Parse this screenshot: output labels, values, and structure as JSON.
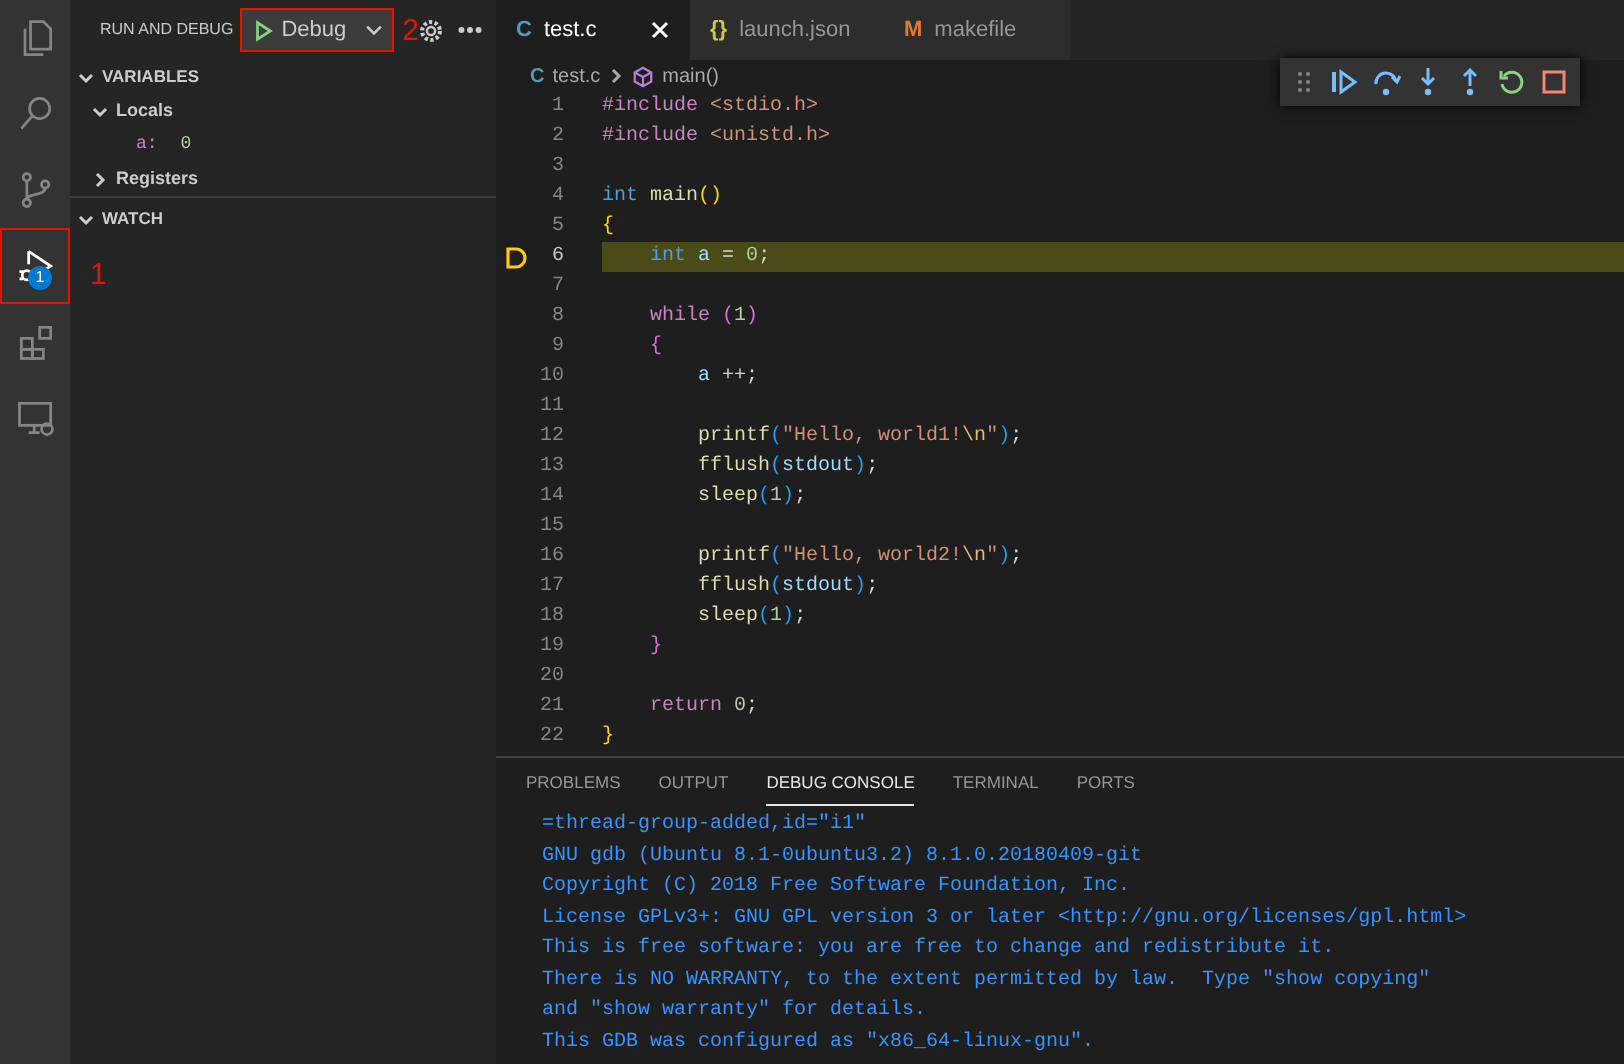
{
  "activity_bar": {
    "items": [
      {
        "kind": "explorer",
        "selected": false
      },
      {
        "kind": "search",
        "selected": false
      },
      {
        "kind": "source_control",
        "selected": false
      },
      {
        "kind": "run_debug",
        "selected": true,
        "badge": "1",
        "annotation": "1"
      },
      {
        "kind": "extensions",
        "selected": false
      },
      {
        "kind": "remote",
        "selected": false
      }
    ]
  },
  "sidebar": {
    "title": "RUN AND DEBUG",
    "launch_button": {
      "label": "Debug",
      "annotation": "2"
    },
    "sections": [
      {
        "title": "VARIABLES",
        "expanded": true,
        "children": [
          {
            "kind": "scope",
            "label": "Locals",
            "expanded": true,
            "children": [
              {
                "kind": "variable",
                "name": "a:",
                "value": "0"
              }
            ]
          },
          {
            "kind": "scope",
            "label": "Registers",
            "expanded": false
          }
        ]
      },
      {
        "title": "WATCH",
        "expanded": true
      }
    ]
  },
  "editor": {
    "tabs": [
      {
        "label": "test.c",
        "icon": "C",
        "kind": "c",
        "selected": true
      },
      {
        "label": "launch.json",
        "icon": "{}",
        "kind": "json",
        "selected": false
      },
      {
        "label": "makefile",
        "icon": "M",
        "kind": "make",
        "selected": false
      }
    ],
    "breadcrumb": [
      {
        "kind": "file",
        "icon": "C",
        "label": "test.c"
      },
      {
        "kind": "function",
        "label": "main()"
      }
    ],
    "debug_toolbar": [
      {
        "kind": "grip"
      },
      {
        "kind": "continue"
      },
      {
        "kind": "step_over"
      },
      {
        "kind": "step_into"
      },
      {
        "kind": "step_out"
      },
      {
        "kind": "restart"
      },
      {
        "kind": "stop"
      }
    ],
    "lines": [
      {
        "number": "1",
        "current": false,
        "tokens": [
          {
            "t": "#include",
            "kind": "pre"
          },
          {
            "t": " <stdio.h>",
            "kind": "str"
          }
        ]
      },
      {
        "number": "2",
        "current": false,
        "tokens": [
          {
            "t": "#include",
            "kind": "pre"
          },
          {
            "t": " <unistd.h>",
            "kind": "str"
          }
        ]
      },
      {
        "number": "3",
        "current": false
      },
      {
        "number": "4",
        "current": false,
        "tokens": [
          {
            "t": "int",
            "kind": "type"
          },
          {
            "t": " main",
            "kind": "fn"
          },
          {
            "t": "()",
            "kind": "b1"
          }
        ]
      },
      {
        "number": "5",
        "current": false,
        "tokens": [
          {
            "t": "{",
            "kind": "b1"
          }
        ]
      },
      {
        "number": "6",
        "current": true,
        "tokens": [
          {
            "t": "    int",
            "kind": "type"
          },
          {
            "t": " a",
            "kind": "var"
          },
          {
            "t": " = ",
            "kind": "plain"
          },
          {
            "t": "0",
            "kind": "num"
          },
          {
            "t": ";",
            "kind": "plain"
          }
        ]
      },
      {
        "number": "7",
        "current": false
      },
      {
        "number": "8",
        "current": false,
        "tokens": [
          {
            "t": "    while",
            "kind": "kw"
          },
          {
            "t": " (",
            "kind": "b2"
          },
          {
            "t": "1",
            "kind": "num"
          },
          {
            "t": ")",
            "kind": "b2"
          }
        ]
      },
      {
        "number": "9",
        "current": false,
        "tokens": [
          {
            "t": "    {",
            "kind": "b2"
          }
        ]
      },
      {
        "number": "10",
        "current": false,
        "tokens": [
          {
            "t": "        a",
            "kind": "var"
          },
          {
            "t": " ++;",
            "kind": "plain"
          }
        ]
      },
      {
        "number": "11",
        "current": false
      },
      {
        "number": "12",
        "current": false,
        "tokens": [
          {
            "t": "        printf",
            "kind": "fn"
          },
          {
            "t": "(",
            "kind": "b3"
          },
          {
            "t": "\"Hello, world1!",
            "kind": "str"
          },
          {
            "t": "\\n",
            "kind": "esc"
          },
          {
            "t": "\"",
            "kind": "str"
          },
          {
            "t": ")",
            "kind": "b3"
          },
          {
            "t": ";",
            "kind": "plain"
          }
        ]
      },
      {
        "number": "13",
        "current": false,
        "tokens": [
          {
            "t": "        fflush",
            "kind": "fn"
          },
          {
            "t": "(",
            "kind": "b3"
          },
          {
            "t": "stdout",
            "kind": "var"
          },
          {
            "t": ")",
            "kind": "b3"
          },
          {
            "t": ";",
            "kind": "plain"
          }
        ]
      },
      {
        "number": "14",
        "current": false,
        "tokens": [
          {
            "t": "        sleep",
            "kind": "fn"
          },
          {
            "t": "(",
            "kind": "b3"
          },
          {
            "t": "1",
            "kind": "num"
          },
          {
            "t": ")",
            "kind": "b3"
          },
          {
            "t": ";",
            "kind": "plain"
          }
        ]
      },
      {
        "number": "15",
        "current": false
      },
      {
        "number": "16",
        "current": false,
        "tokens": [
          {
            "t": "        printf",
            "kind": "fn"
          },
          {
            "t": "(",
            "kind": "b3"
          },
          {
            "t": "\"Hello, world2!",
            "kind": "str"
          },
          {
            "t": "\\n",
            "kind": "esc"
          },
          {
            "t": "\"",
            "kind": "str"
          },
          {
            "t": ")",
            "kind": "b3"
          },
          {
            "t": ";",
            "kind": "plain"
          }
        ]
      },
      {
        "number": "17",
        "current": false,
        "tokens": [
          {
            "t": "        fflush",
            "kind": "fn"
          },
          {
            "t": "(",
            "kind": "b3"
          },
          {
            "t": "stdout",
            "kind": "var"
          },
          {
            "t": ")",
            "kind": "b3"
          },
          {
            "t": ";",
            "kind": "plain"
          }
        ]
      },
      {
        "number": "18",
        "current": false,
        "tokens": [
          {
            "t": "        sleep",
            "kind": "fn"
          },
          {
            "t": "(",
            "kind": "b3"
          },
          {
            "t": "1",
            "kind": "num"
          },
          {
            "t": ")",
            "kind": "b3"
          },
          {
            "t": ";",
            "kind": "plain"
          }
        ]
      },
      {
        "number": "19",
        "current": false,
        "tokens": [
          {
            "t": "    }",
            "kind": "b2"
          }
        ]
      },
      {
        "number": "20",
        "current": false
      },
      {
        "number": "21",
        "current": false,
        "tokens": [
          {
            "t": "    return",
            "kind": "kw"
          },
          {
            "t": " 0",
            "kind": "num"
          },
          {
            "t": ";",
            "kind": "plain"
          }
        ]
      },
      {
        "number": "22",
        "current": false,
        "tokens": [
          {
            "t": "}",
            "kind": "b1"
          }
        ]
      }
    ]
  },
  "panel": {
    "tabs": [
      {
        "label": "PROBLEMS",
        "selected": false
      },
      {
        "label": "OUTPUT",
        "selected": false
      },
      {
        "label": "DEBUG CONSOLE",
        "selected": true
      },
      {
        "label": "TERMINAL",
        "selected": false
      },
      {
        "label": "PORTS",
        "selected": false
      }
    ],
    "console": [
      "=thread-group-added,id=\"i1\"",
      "GNU gdb (Ubuntu 8.1-0ubuntu3.2) 8.1.0.20180409-git",
      "Copyright (C) 2018 Free Software Foundation, Inc.",
      "License GPLv3+: GNU GPL version 3 or later <http://gnu.org/licenses/gpl.html>",
      "This is free software: you are free to change and redistribute it.",
      "There is NO WARRANTY, to the extent permitted by law.  Type \"show copying\"",
      "and \"show warranty\" for details.",
      "This GDB was configured as \"x86_64-linux-gnu\"."
    ]
  }
}
